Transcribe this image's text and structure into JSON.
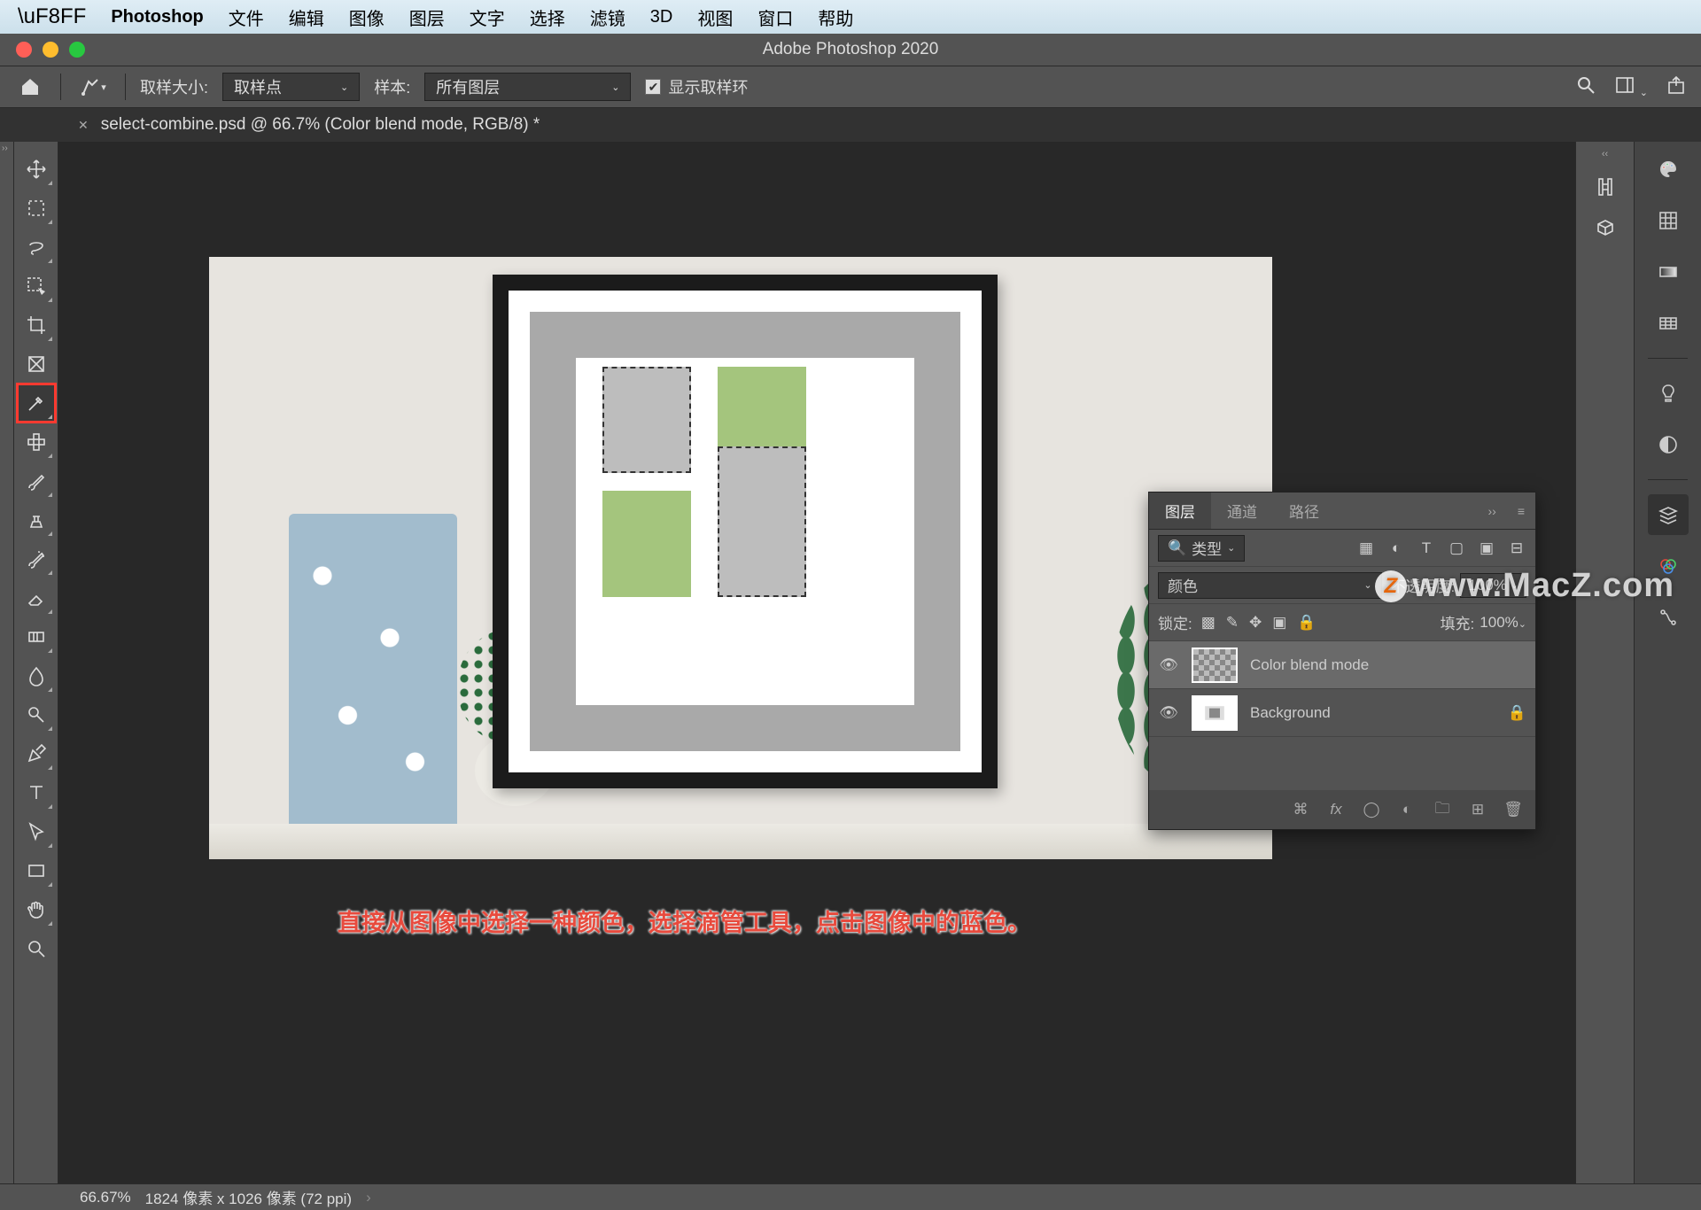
{
  "macMenu": {
    "appName": "Photoshop",
    "items": [
      "文件",
      "编辑",
      "图像",
      "图层",
      "文字",
      "选择",
      "滤镜",
      "3D",
      "视图",
      "窗口",
      "帮助"
    ]
  },
  "window": {
    "title": "Adobe Photoshop 2020"
  },
  "optionsBar": {
    "sampleSizeLabel": "取样大小:",
    "sampleSizeValue": "取样点",
    "sampleLabel": "样本:",
    "sampleValue": "所有图层",
    "showRingLabel": "显示取样环"
  },
  "tab": {
    "title": "select-combine.psd @ 66.7% (Color blend mode, RGB/8) *"
  },
  "toolbar": {
    "tools": [
      {
        "name": "move-tool"
      },
      {
        "name": "marquee-tool"
      },
      {
        "name": "lasso-tool"
      },
      {
        "name": "quick-select-tool"
      },
      {
        "name": "crop-tool"
      },
      {
        "name": "frame-tool"
      },
      {
        "name": "eyedropper-tool",
        "selected": true,
        "highlighted": true
      },
      {
        "name": "healing-brush-tool"
      },
      {
        "name": "brush-tool"
      },
      {
        "name": "clone-stamp-tool"
      },
      {
        "name": "history-brush-tool"
      },
      {
        "name": "eraser-tool"
      },
      {
        "name": "gradient-tool"
      },
      {
        "name": "blur-tool"
      },
      {
        "name": "dodge-tool"
      },
      {
        "name": "pen-tool"
      },
      {
        "name": "text-tool"
      },
      {
        "name": "path-select-tool"
      },
      {
        "name": "rectangle-tool"
      },
      {
        "name": "hand-tool"
      },
      {
        "name": "zoom-tool"
      }
    ]
  },
  "layersPanel": {
    "tabs": {
      "layers": "图层",
      "channels": "通道",
      "paths": "路径"
    },
    "filterLabel": "类型",
    "blendMode": "颜色",
    "opacityLabel": "不透明度:",
    "opacityValue": "100%",
    "lockLabel": "锁定:",
    "fillLabel": "填充:",
    "fillValue": "100%",
    "layers": [
      {
        "name": "Color blend mode",
        "active": true,
        "locked": false,
        "thumb": "checker"
      },
      {
        "name": "Background",
        "active": false,
        "locked": true,
        "thumb": "bg"
      }
    ]
  },
  "statusBar": {
    "zoom": "66.67%",
    "docInfo": "1824 像素 x 1026 像素 (72 ppi)"
  },
  "annotation": "直接从图像中选择一种颜色，选择滴管工具，点击图像中的蓝色。",
  "watermark": "www.MacZ.com"
}
